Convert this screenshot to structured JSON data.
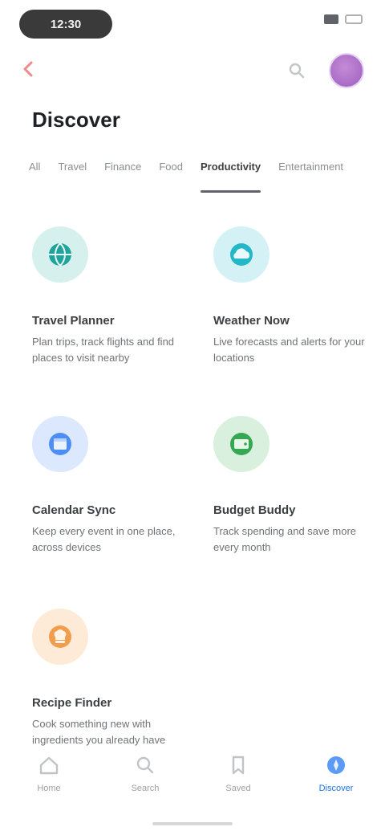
{
  "status_bar": {
    "time": "12:30"
  },
  "page": {
    "title": "Discover"
  },
  "tabs": [
    {
      "label": "All"
    },
    {
      "label": "Travel"
    },
    {
      "label": "Finance"
    },
    {
      "label": "Food"
    },
    {
      "label": "Productivity"
    },
    {
      "label": "Entertainment"
    }
  ],
  "cards": [
    {
      "title": "Travel Planner",
      "desc": "Plan trips, track flights and find places to visit nearby",
      "color": "#1fa39a",
      "icon": "globe-icon"
    },
    {
      "title": "Weather Now",
      "desc": "Live forecasts and alerts for your locations",
      "color": "#23b8c7",
      "icon": "cloud-icon"
    },
    {
      "title": "Calendar Sync",
      "desc": "Keep every event in one place, across devices",
      "color": "#4c8df6",
      "icon": "calendar-icon"
    },
    {
      "title": "Budget Buddy",
      "desc": "Track spending and save more every month",
      "color": "#34a853",
      "icon": "wallet-icon"
    },
    {
      "title": "Recipe Finder",
      "desc": "Cook something new with ingredients you already have",
      "color": "#f29d4b",
      "icon": "chef-hat-icon"
    }
  ],
  "bottom_nav": [
    {
      "label": "Home",
      "icon": "home-icon"
    },
    {
      "label": "Search",
      "icon": "search-icon"
    },
    {
      "label": "Saved",
      "icon": "bookmark-icon"
    },
    {
      "label": "Discover",
      "icon": "compass-icon"
    }
  ],
  "colors": {
    "accent": "#1a73e8",
    "avatar": "#b072cf",
    "back_icon": "#f4a3a3"
  }
}
